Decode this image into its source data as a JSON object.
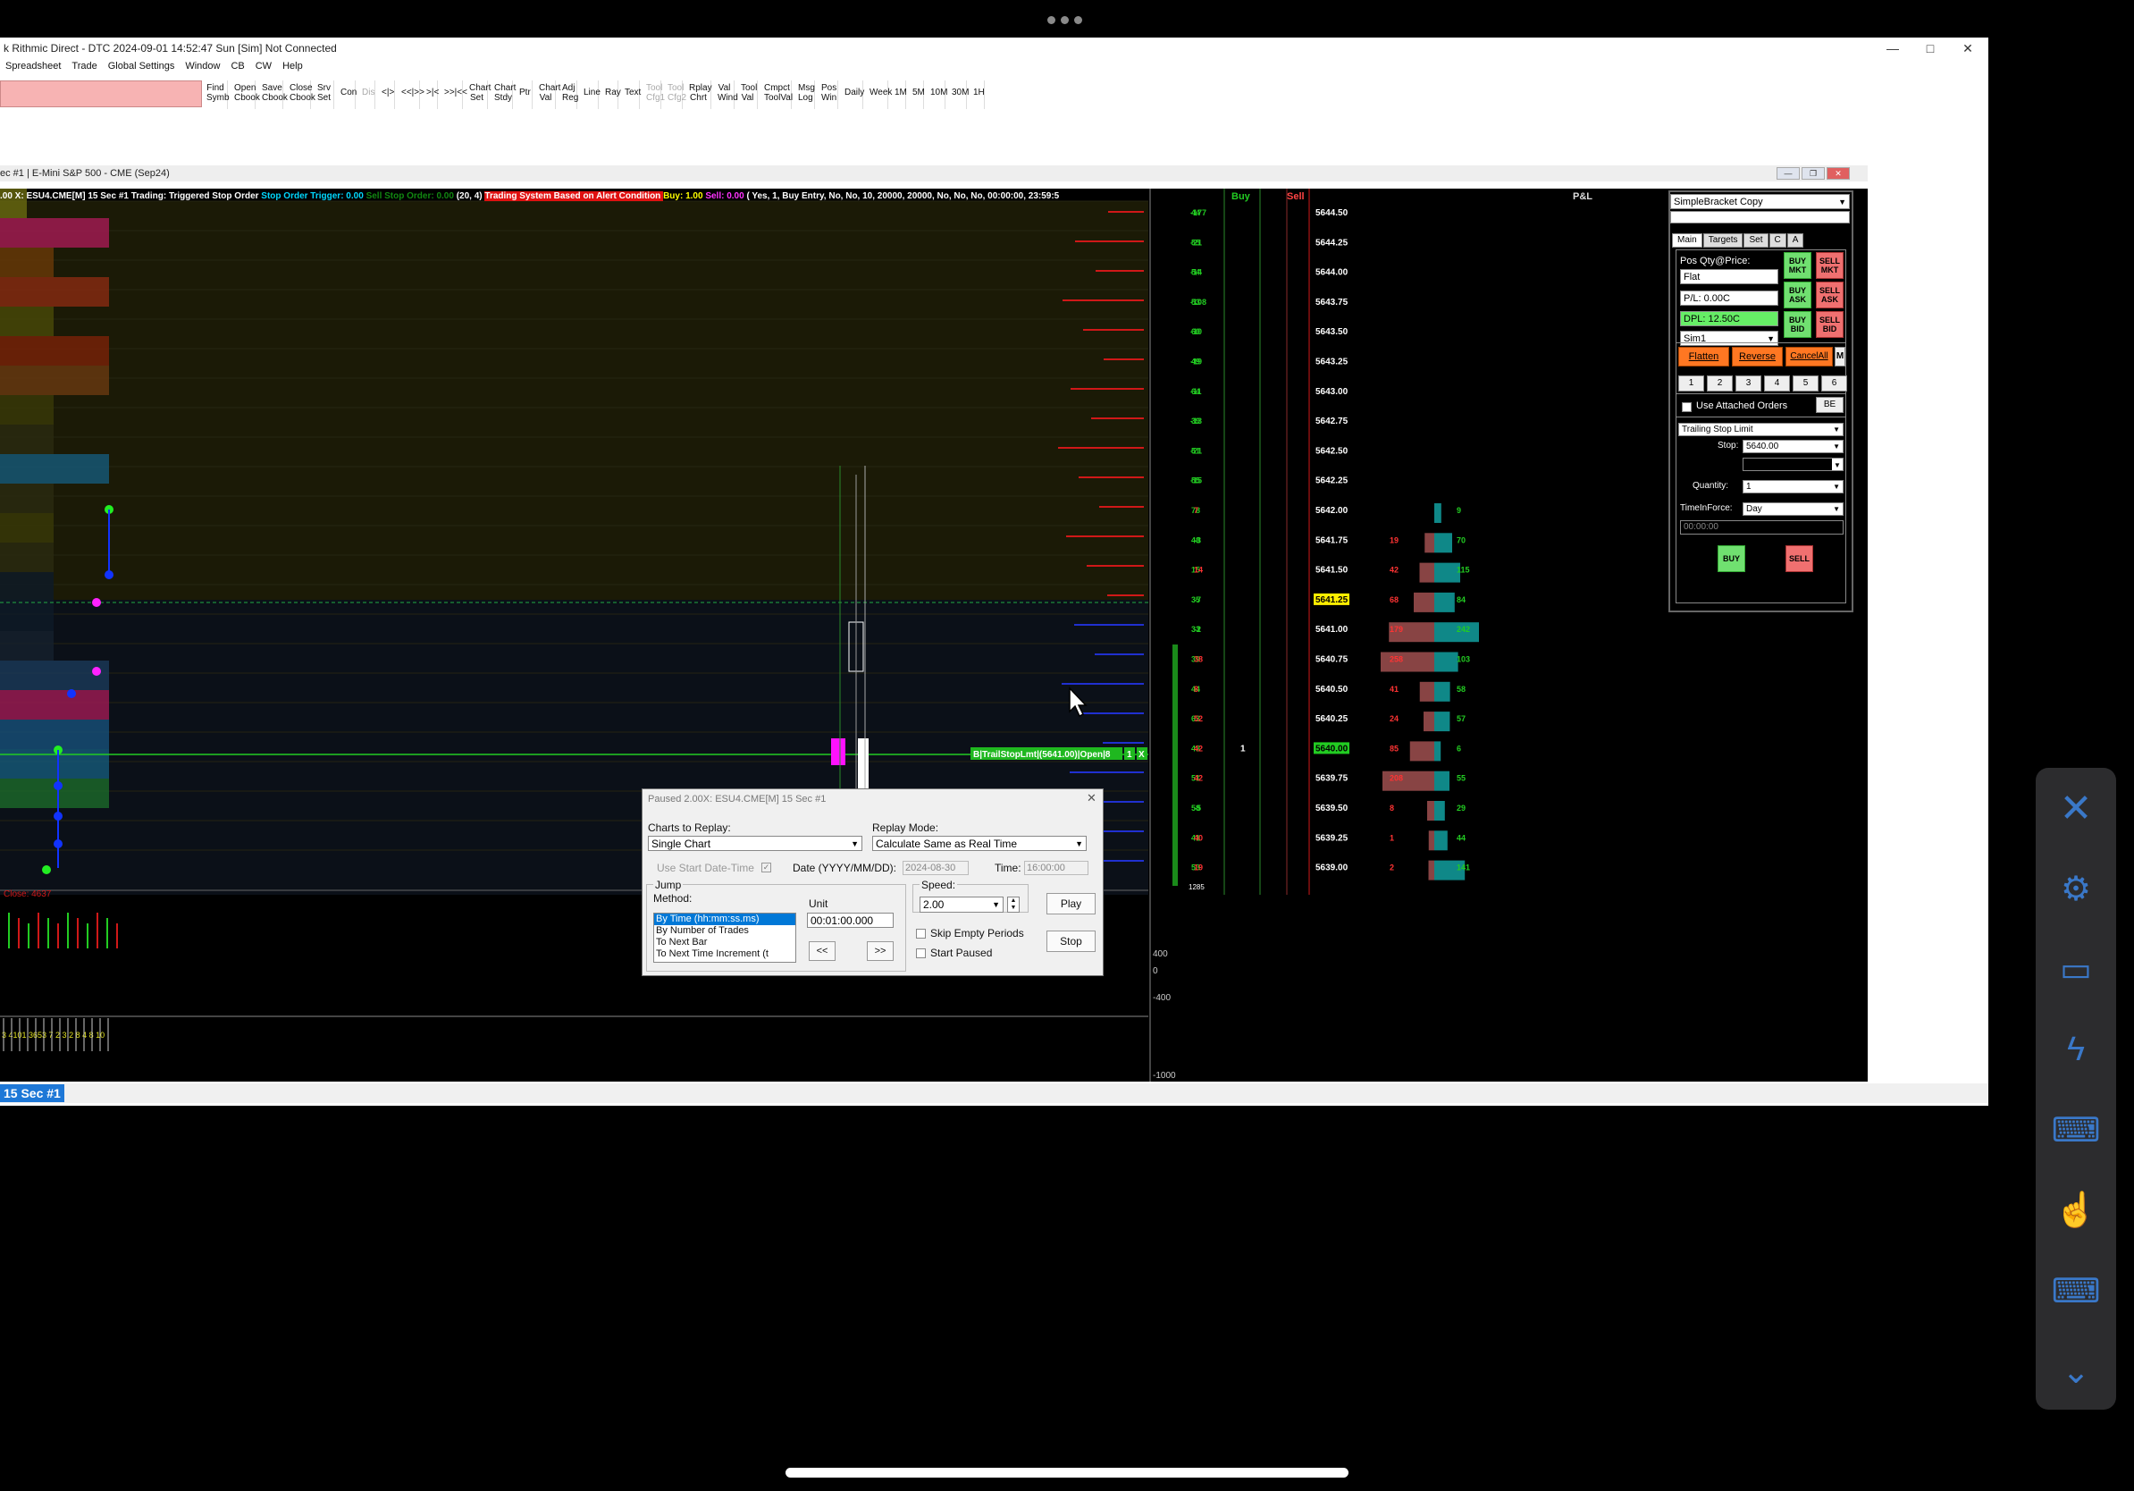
{
  "window": {
    "title": "k Rithmic Direct - DTC 2024-09-01  14:52:47 Sun [Sim] Not Connected",
    "minimize_icon": "minimize-icon",
    "maximize_icon": "maximize-icon",
    "close_icon": "close-icon"
  },
  "menu": [
    "Spreadsheet",
    "Trade",
    "Global Settings",
    "Window",
    "CB",
    "CW",
    "Help"
  ],
  "toolbar": [
    {
      "l1": "Find",
      "l2": "Symb",
      "dis": false
    },
    {
      "l1": "Open",
      "l2": "Cbook",
      "dis": false
    },
    {
      "l1": "Save",
      "l2": "Cbook",
      "dis": false
    },
    {
      "l1": "Close",
      "l2": "Cbook",
      "dis": false
    },
    {
      "l1": "Srv",
      "l2": "Set",
      "dis": false
    },
    {
      "l1": "Con",
      "l2": "",
      "dis": false
    },
    {
      "l1": "Dis",
      "l2": "",
      "dis": true
    },
    {
      "l1": "<|>",
      "l2": "",
      "dis": false
    },
    {
      "l1": "<<|>>",
      "l2": "",
      "dis": false
    },
    {
      "l1": ">|<",
      "l2": "",
      "dis": false
    },
    {
      "l1": ">>|<<",
      "l2": "",
      "dis": false
    },
    {
      "l1": "Chart",
      "l2": "Set",
      "dis": false
    },
    {
      "l1": "Chart",
      "l2": "Stdy",
      "dis": false
    },
    {
      "l1": "Ptr",
      "l2": "",
      "dis": false
    },
    {
      "l1": "Chart",
      "l2": "Val",
      "dis": false
    },
    {
      "l1": "Adj",
      "l2": "Reg",
      "dis": false
    },
    {
      "l1": "Line",
      "l2": "",
      "dis": false
    },
    {
      "l1": "Ray",
      "l2": "",
      "dis": false
    },
    {
      "l1": "Text",
      "l2": "",
      "dis": false
    },
    {
      "l1": "Tool",
      "l2": "Cfg1",
      "dis": true
    },
    {
      "l1": "Tool",
      "l2": "Cfg2",
      "dis": true
    },
    {
      "l1": "Rplay",
      "l2": "Chrt",
      "dis": false
    },
    {
      "l1": "Val",
      "l2": "Wind",
      "dis": false
    },
    {
      "l1": "Tool",
      "l2": "Val",
      "dis": false
    },
    {
      "l1": "Cmpct",
      "l2": "ToolVal",
      "dis": false
    },
    {
      "l1": "Msg",
      "l2": "Log",
      "dis": false
    },
    {
      "l1": "Pos",
      "l2": "Win",
      "dis": false
    },
    {
      "l1": "Daily",
      "l2": "",
      "dis": false
    },
    {
      "l1": "Week",
      "l2": "",
      "dis": false
    },
    {
      "l1": "1M",
      "l2": "",
      "dis": false
    },
    {
      "l1": "5M",
      "l2": "",
      "dis": false
    },
    {
      "l1": "10M",
      "l2": "",
      "dis": false
    },
    {
      "l1": "30M",
      "l2": "",
      "dis": false
    },
    {
      "l1": "1H",
      "l2": "",
      "dis": false
    }
  ],
  "chart": {
    "title": "ec #1 | E-Mini S&P 500 - CME (Sep24)",
    "status_parts": [
      {
        "t": ".00 X: ESU4.CME[M]  15 Sec  #1 Trading: Triggered Stop Order ",
        "c": "#ffffff"
      },
      {
        "t": "Stop Order Trigger: 0.00 ",
        "c": "#00d8ff"
      },
      {
        "t": "Sell Stop Order: 0.00 ",
        "c": "#118811"
      },
      {
        "t": " (20, 4) ",
        "c": "#ffffff"
      },
      {
        "t": " Trading System Based on Alert Condition ",
        "c": "#ffffff",
        "bg": "#e01010"
      },
      {
        "t": "Buy: 1.00 ",
        "c": "#ffff00"
      },
      {
        "t": "Sell: 0.00 ",
        "c": "#ff33ff"
      },
      {
        "t": " ( Yes, 1, Buy Entry, No, No, 10, 20000, 20000, No, No, No, 00:00:00, 23:59:5",
        "c": "#ffffff"
      }
    ],
    "close_label": "Close: 4637",
    "order_label": "B|TrailStopLmt|(5641.00)|Open|8",
    "order_qty": "1",
    "order_x": "X",
    "subgraph_labels": [
      "400",
      "0",
      "-400",
      "-1000"
    ],
    "bottom_volume_labels": "3 4101 3653 7 2 3 2 8 4 8 10"
  },
  "ladder": {
    "header_buy": "Buy",
    "header_sell": "Sell",
    "header_pnl": "P&L",
    "footer_num": "1285",
    "prices": [
      "5644.50",
      "5644.25",
      "5644.00",
      "5643.75",
      "5643.50",
      "5643.25",
      "5643.00",
      "5642.75",
      "5642.50",
      "5642.25",
      "5642.00",
      "5641.75",
      "5641.50",
      "5641.25",
      "5641.00",
      "5640.75",
      "5640.50",
      "5640.25",
      "5640.00",
      "5639.75",
      "5639.50",
      "5639.25",
      "5639.00"
    ],
    "col1": [
      "44",
      "55",
      "54",
      "53",
      "60",
      "49",
      "64",
      "39",
      "51",
      "55",
      "78",
      "48",
      "15",
      "35",
      "33",
      "39",
      "44",
      "63",
      "48",
      "51",
      "58",
      "41",
      "53"
    ],
    "col2": [
      "-177",
      "-21",
      "-14",
      "-108",
      "-10",
      "-19",
      "-11",
      "-13",
      "-21",
      "-15",
      "7",
      "-3",
      "14",
      "-7",
      "-2",
      "38",
      "8",
      "52",
      "42",
      "42",
      "-5",
      "40",
      "19"
    ],
    "buy_qty_row": 18,
    "buy_qty": "1",
    "right_sell": [
      "",
      "",
      "",
      "",
      "",
      "",
      "",
      "",
      "",
      "",
      "",
      "19",
      "42",
      "68",
      "179",
      "258",
      "41",
      "24",
      "85",
      "208",
      "8",
      "1",
      "2"
    ],
    "right_buy": [
      "",
      "",
      "",
      "",
      "",
      "",
      "",
      "",
      "",
      "",
      "9",
      "70",
      "115",
      "84",
      "242",
      "103",
      "58",
      "57",
      "6",
      "55",
      "29",
      "44",
      "141"
    ]
  },
  "trade_panel": {
    "account_select": "SimpleBracket Copy",
    "tabs": [
      "Main",
      "Targets",
      "Set",
      "C",
      "A"
    ],
    "pos_label": "Pos Qty@Price:",
    "pos_value": "Flat",
    "pl_value": "P/L: 0.00C",
    "dpl_value": "DPL: 12.50C",
    "account": "Sim1",
    "buy_mkt": [
      "BUY",
      "MKT"
    ],
    "sell_mkt": [
      "SELL",
      "MKT"
    ],
    "buy_ask": [
      "BUY",
      "ASK"
    ],
    "sell_ask": [
      "SELL",
      "ASK"
    ],
    "buy_bid": [
      "BUY",
      "BID"
    ],
    "sell_bid": [
      "SELL",
      "BID"
    ],
    "flatten": "Flatten",
    "reverse": "Reverse",
    "cancel_all": "CancelAll",
    "m": "M",
    "qty_buttons": [
      "1",
      "2",
      "3",
      "4",
      "5",
      "6"
    ],
    "attached_label": "Use Attached Orders",
    "be": "BE",
    "order_type": "Trailing Stop Limit",
    "stop_label": "Stop:",
    "stop_value": "5640.00",
    "quantity_label": "Quantity:",
    "quantity_value": "1",
    "tif_label": "TimeInForce:",
    "tif_value": "Day",
    "time_value": "00:00:00",
    "buy": "BUY",
    "sell": "SELL"
  },
  "replay": {
    "title": "Paused 2.00X: ESU4.CME[M]  15 Sec  #1",
    "charts_label": "Charts to Replay:",
    "charts_value": "Single Chart",
    "mode_label": "Replay Mode:",
    "mode_value": "Calculate Same as Real Time",
    "use_start": "Use Start Date-Time",
    "date_label": "Date (YYYY/MM/DD):",
    "date_value": "2024-08-30",
    "time_label": "Time:",
    "time_value": "16:00:00",
    "jump_label": "Jump",
    "method_label": "Method:",
    "methods": [
      "By Time (hh:mm:ss.ms)",
      "By Number of Trades",
      "To Next Bar",
      "To Next Time Increment (t"
    ],
    "unit_label": "Unit",
    "unit_value": "00:01:00.000",
    "back": "<<",
    "fwd": ">>",
    "speed_label": "Speed:",
    "speed_value": "2.00",
    "skip_label": "Skip Empty Periods",
    "start_paused": "Start Paused",
    "play": "Play",
    "stop": "Stop"
  },
  "bottom_tab": "15 Sec  #1",
  "side_toolbar": [
    "close-icon",
    "gear-icon",
    "monitor-icon",
    "lightning-icon",
    "keyboard-mouse-icon",
    "touch-icon",
    "keyboard-icon",
    "chevron-down-icon"
  ]
}
